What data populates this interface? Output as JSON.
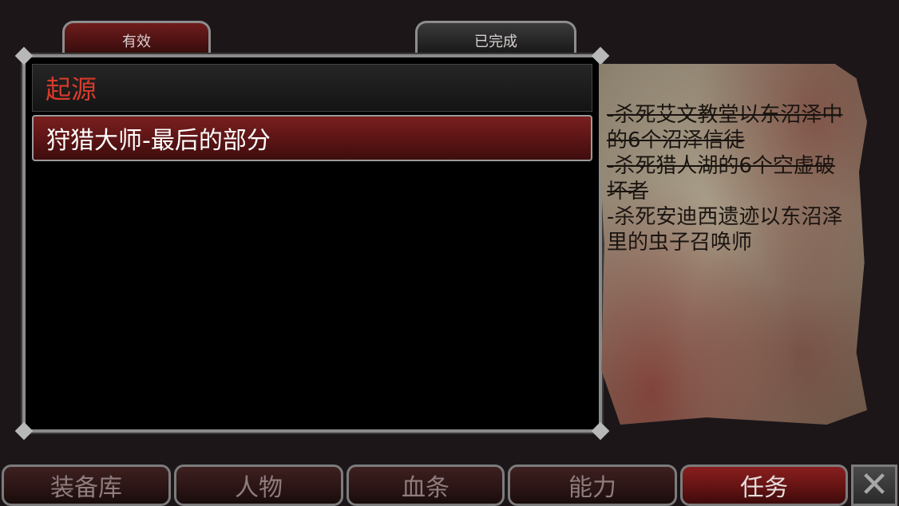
{
  "tabs": {
    "active": "有效",
    "completed": "已完成"
  },
  "quest_list": {
    "category": "起源",
    "selected_quest": "狩猎大师-最后的部分"
  },
  "objectives": [
    {
      "text": "-杀死艾文教堂以东沼泽中的6个沼泽信徒",
      "completed": true
    },
    {
      "text": "-杀死猎人湖的6个空虚破坏者",
      "completed": true
    },
    {
      "text": "-杀死安迪西遗迹以东沼泽里的虫子召唤师",
      "completed": false
    }
  ],
  "nav": {
    "inventory": "装备库",
    "character": "人物",
    "bloodline": "血条",
    "abilities": "能力",
    "quests": "任务",
    "active_tab": "quests"
  },
  "icons": {
    "close": "close-icon"
  },
  "colors": {
    "category_text": "#d83a2c",
    "selected_row": "#6a1818",
    "parchment": "#9a8e7a"
  }
}
